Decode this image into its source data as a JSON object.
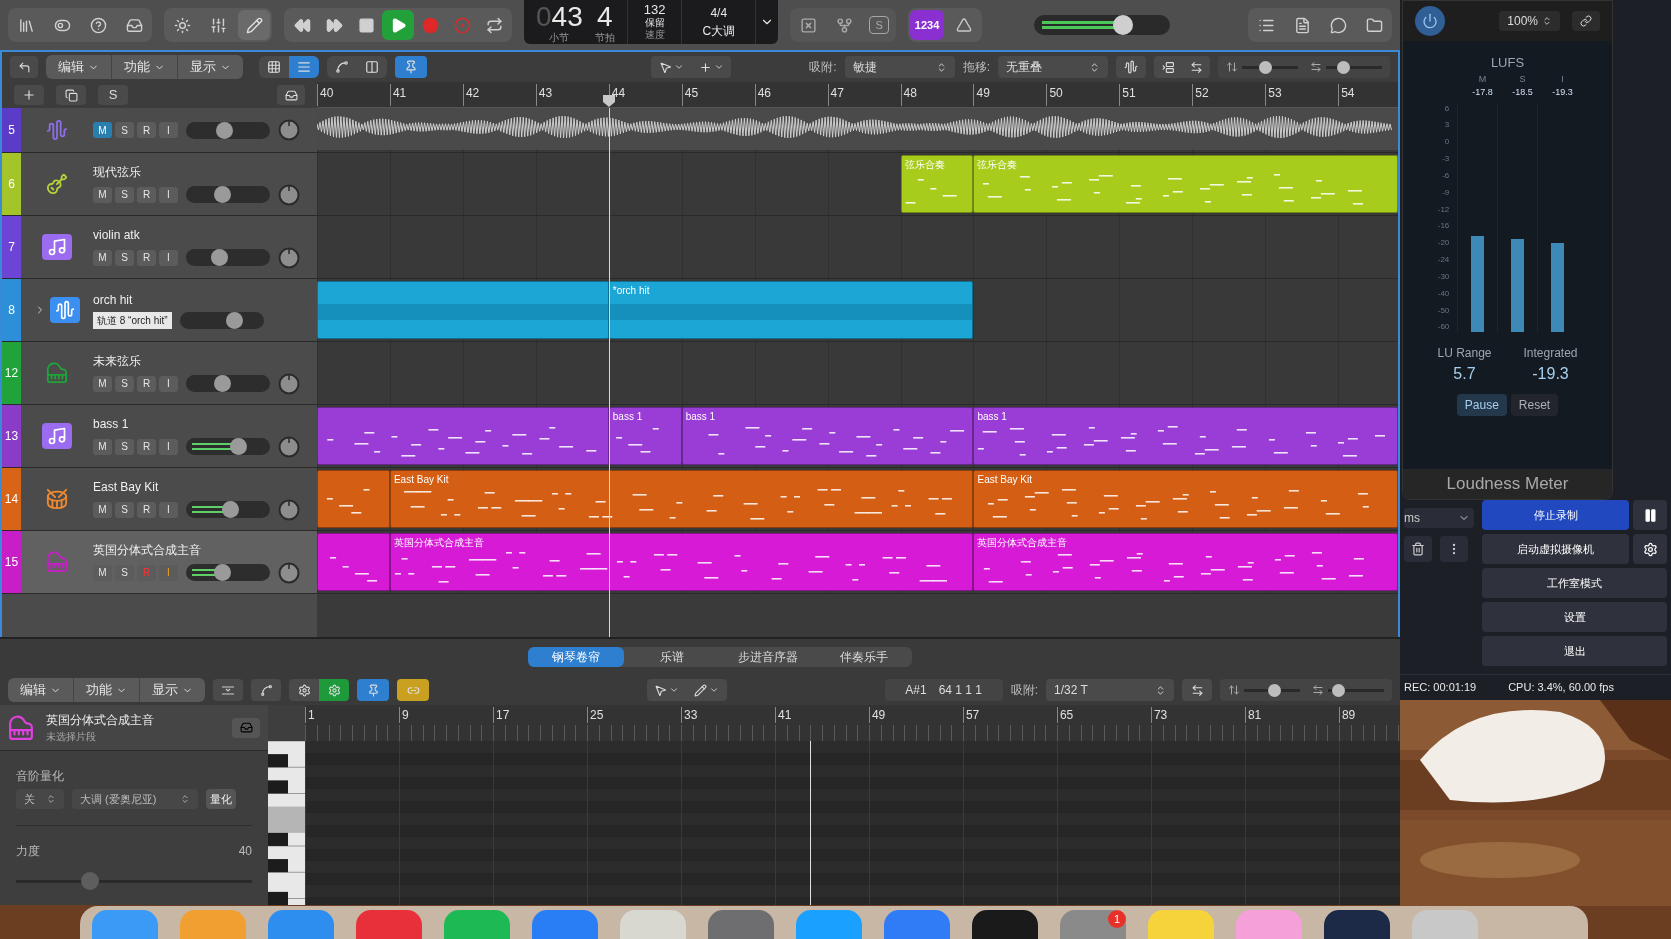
{
  "control_bar": {
    "left_buttons": [
      {
        "kind": "library",
        "on": false
      },
      {
        "kind": "toggles",
        "on": false
      },
      {
        "kind": "help",
        "on": false
      },
      {
        "kind": "download",
        "on": false
      }
    ],
    "view_buttons": [
      {
        "kind": "brightness",
        "on": false
      },
      {
        "kind": "mixer",
        "on": false
      },
      {
        "kind": "pencil",
        "on": true
      }
    ],
    "transport": [
      {
        "kind": "rewind",
        "on": false
      },
      {
        "kind": "forward",
        "on": false
      },
      {
        "kind": "stop",
        "on": false
      },
      {
        "kind": "play",
        "on": true
      },
      {
        "kind": "record",
        "on": false
      },
      {
        "kind": "capture",
        "on": false
      },
      {
        "kind": "cycle",
        "on": false
      }
    ],
    "lcd": {
      "bar_prefix": "0",
      "bar": "43",
      "beat": "4",
      "bar_label": "小节",
      "beat_label": "节拍",
      "tempo": "132",
      "tempo_mode": "保留",
      "tempo_label": "速度",
      "signature": "4/4",
      "key": "C大调"
    },
    "mode_buttons": [
      {
        "kind": "replace"
      },
      {
        "kind": "tuner"
      },
      {
        "kind": "solo",
        "label": "S"
      }
    ],
    "count_in": {
      "label": "1234",
      "on": true
    },
    "master_volume": {
      "level": 0.68
    },
    "right_buttons": [
      {
        "kind": "list"
      },
      {
        "kind": "notes"
      },
      {
        "kind": "loops"
      },
      {
        "kind": "browser"
      }
    ]
  },
  "tracks_toolbar": {
    "menus": [
      "编辑",
      "功能",
      "显示"
    ],
    "view_toggles": [
      {
        "kind": "grid",
        "selected": false
      },
      {
        "kind": "list",
        "selected": true
      }
    ],
    "catch_on": true,
    "snap_label": "吸附:",
    "snap_value": "敏捷",
    "drag_label": "拖移:",
    "drag_value": "无重叠",
    "vertical_zoom": {
      "level": 0.4
    },
    "horizontal_zoom": {
      "level": 0.25
    }
  },
  "track_list_header": {
    "solo_label": "S"
  },
  "ruler": [
    "40",
    "41",
    "42",
    "43",
    "44",
    "45",
    "46",
    "47",
    "48",
    "49",
    "50",
    "51",
    "52",
    "53",
    "54"
  ],
  "tracks": [
    {
      "number": "5",
      "color": "#5a3cc8",
      "kind": "audio",
      "selected": false,
      "buttons": [
        {
          "label": "M",
          "on": true
        },
        {
          "label": "S",
          "on": false
        },
        {
          "label": "R",
          "on": false
        },
        {
          "label": "I",
          "on": false
        }
      ],
      "fader": {
        "level": 0.45
      },
      "metering": false,
      "regions": [
        {
          "kind": "audio"
        }
      ]
    },
    {
      "number": "6",
      "name": "现代弦乐",
      "color": "#a3c52a",
      "kind": "strings",
      "selected": false,
      "buttons": [
        {
          "label": "M",
          "on": false
        },
        {
          "label": "S",
          "on": false
        },
        {
          "label": "R",
          "on": false
        },
        {
          "label": "I",
          "on": false
        }
      ],
      "fader": {
        "level": 0.42
      },
      "metering": false,
      "regions": [
        {
          "kind": "midi",
          "name": "弦乐合奏"
        },
        {
          "kind": "midi",
          "name": "弦乐合奏"
        }
      ]
    },
    {
      "number": "7",
      "name": "violin atk",
      "color": "#6c44d6",
      "kind": "instrument",
      "selected": false,
      "buttons": [
        {
          "label": "M",
          "on": false
        },
        {
          "label": "S",
          "on": false
        },
        {
          "label": "R",
          "on": false
        },
        {
          "label": "I",
          "on": false
        }
      ],
      "fader": {
        "level": 0.38
      },
      "metering": false
    },
    {
      "number": "8",
      "name": "orch hit",
      "color": "#2d8fd8",
      "kind": "audio",
      "selected": false,
      "expandable": true,
      "tooltip": "轨道 8 “orch hit”",
      "fader": {
        "level": 0.7
      },
      "metering": false,
      "regions": [
        {
          "kind": "audio_block"
        },
        {
          "kind": "audio_block",
          "name": "*orch hit"
        }
      ]
    },
    {
      "number": "12",
      "name": "未来弦乐",
      "color": "#1fa33a",
      "kind": "keyboard",
      "selected": false,
      "buttons": [
        {
          "label": "M",
          "on": false
        },
        {
          "label": "S",
          "on": false
        },
        {
          "label": "R",
          "on": false
        },
        {
          "label": "I",
          "on": false
        }
      ],
      "fader": {
        "level": 0.42
      },
      "metering": false
    },
    {
      "number": "13",
      "name": "bass 1",
      "color": "#8a3bc8",
      "kind": "instrument",
      "selected": false,
      "buttons": [
        {
          "label": "M",
          "on": false
        },
        {
          "label": "S",
          "on": false
        },
        {
          "label": "R",
          "on": false
        },
        {
          "label": "I",
          "on": false
        }
      ],
      "fader": {
        "level": 0.65
      },
      "metering": true,
      "regions": [
        {
          "kind": "midi"
        },
        {
          "kind": "midi",
          "name": "bass 1"
        },
        {
          "kind": "midi",
          "name": "bass 1"
        },
        {
          "kind": "midi",
          "name": "bass 1"
        }
      ]
    },
    {
      "number": "14",
      "name": "East Bay Kit",
      "color": "#d86418",
      "kind": "drums",
      "selected": false,
      "buttons": [
        {
          "label": "M",
          "on": false
        },
        {
          "label": "S",
          "on": false
        },
        {
          "label": "R",
          "on": false
        },
        {
          "label": "I",
          "on": false
        }
      ],
      "fader": {
        "level": 0.53
      },
      "metering": true,
      "regions": [
        {
          "kind": "midi"
        },
        {
          "kind": "midi",
          "name": "East Bay Kit"
        },
        {
          "kind": "midi",
          "name": "East Bay Kit"
        }
      ]
    },
    {
      "number": "15",
      "name": "英国分体式合成主音",
      "color": "#c81ec8",
      "kind": "keyboard",
      "selected": true,
      "buttons": [
        {
          "label": "M",
          "on": false
        },
        {
          "label": "S",
          "on": false
        },
        {
          "label": "R",
          "on": true
        },
        {
          "label": "I",
          "on": true
        }
      ],
      "fader": {
        "level": 0.42
      },
      "metering": true,
      "regions": [
        {
          "kind": "midi"
        },
        {
          "kind": "midi",
          "name": "英国分体式合成主音"
        },
        {
          "kind": "midi",
          "name": "英国分体式合成主音"
        }
      ]
    }
  ],
  "editor": {
    "tabs": [
      {
        "label": "钢琴卷帘",
        "selected": true
      },
      {
        "label": "乐谱",
        "selected": false
      },
      {
        "label": "步进音序器",
        "selected": false
      },
      {
        "label": "伴奏乐手",
        "selected": false
      }
    ],
    "menus": [
      "编辑",
      "功能",
      "显示"
    ],
    "midi_out_on": false,
    "midi_in_on": true,
    "catch_on": true,
    "link_on": true,
    "position_note": "A#1",
    "position_time": "64 1 1 1",
    "snap_label": "吸附:",
    "snap_value": "1/32 T",
    "vertical_zoom": {
      "level": 0.55
    },
    "horizontal_zoom": {
      "level": 0.1
    },
    "region_name": "英国分体式合成主音",
    "region_status": "未选择片段",
    "scale_quantize": {
      "label": "音阶量化",
      "mode": "关",
      "scale": "大调 (爱奥尼亚)",
      "button": "量化"
    },
    "velocity": {
      "label": "力度",
      "value": "40",
      "level": 0.3
    },
    "ruler": [
      "1",
      "9",
      "17",
      "25",
      "33",
      "41",
      "49",
      "57",
      "65",
      "73",
      "81",
      "89"
    ]
  },
  "loudness_meter": {
    "power_on": true,
    "zoom": "100%",
    "unit": "LUFS",
    "columns": [
      {
        "label": "M",
        "value": "-17.8",
        "level": 0.42
      },
      {
        "label": "S",
        "value": "-18.5",
        "level": 0.405
      },
      {
        "label": "I",
        "value": "-19.3",
        "level": 0.39
      }
    ],
    "scale": [
      "6",
      "3",
      "0",
      "-3",
      "-6",
      "-9",
      "-12",
      "-16",
      "-20",
      "-24",
      "-30",
      "-40",
      "-50",
      "-60"
    ],
    "lu_range_label": "LU Range",
    "lu_range": "5.7",
    "integrated_label": "Integrated",
    "integrated": "-19.3",
    "buttons": [
      {
        "label": "Pause",
        "selected": true
      },
      {
        "label": "Reset",
        "selected": false
      }
    ],
    "title": "Loudness Meter"
  },
  "obs": {
    "delay": "ms",
    "buttons": [
      {
        "label": "停止录制",
        "kind": "primary"
      },
      {
        "label": "启动虚拟摄像机",
        "kind": "with_settings"
      },
      {
        "label": "工作室模式",
        "kind": "plain"
      },
      {
        "label": "设置",
        "kind": "plain"
      },
      {
        "label": "退出",
        "kind": "plain"
      }
    ],
    "rec": "REC: 00:01:19",
    "cpu": "CPU: 3.4%, 60.00 fps"
  },
  "dock": [
    {
      "color": "#3a9af5"
    },
    {
      "color": "#f0a030"
    },
    {
      "color": "#2d8ef0"
    },
    {
      "color": "#e8303a"
    },
    {
      "color": "#1db954"
    },
    {
      "color": "#2a7ef5"
    },
    {
      "color": "#d8d8d0"
    },
    {
      "color": "#6e6e70"
    },
    {
      "color": "#1aa0ff"
    },
    {
      "color": "#2f7cf6"
    },
    {
      "color": "#1a1a1a"
    },
    {
      "color": "#8a8a8a",
      "badge": "1"
    },
    {
      "color": "#f7d33b"
    },
    {
      "color": "#f5a0d8"
    },
    {
      "color": "#1c2a48"
    },
    {
      "color": "#c8c8c8"
    }
  ]
}
